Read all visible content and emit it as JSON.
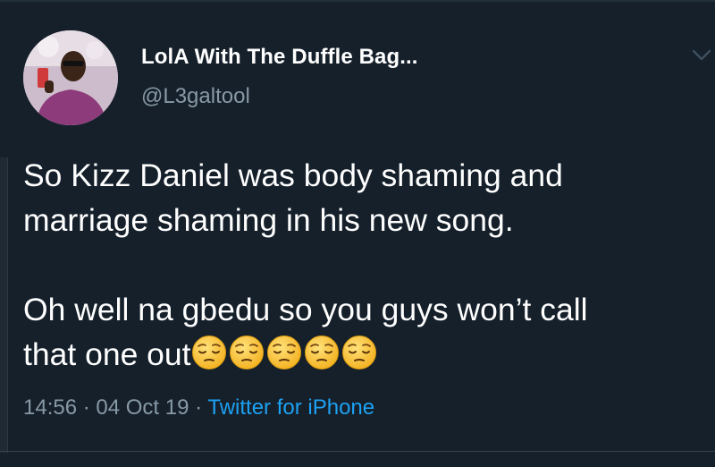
{
  "tweet": {
    "display_name": "LolA With The Duffle Bag...",
    "handle": "@L3galtool",
    "text_line1": "So Kizz Daniel was body shaming and",
    "text_line2": "marriage shaming in his new song.",
    "text_line3": "Oh well na gbedu so you guys won’t call",
    "text_line4": "that one out",
    "emoji_name": "pensive-face-emoji",
    "emoji_count": 5,
    "time": "14:56",
    "separator": " · ",
    "date": "04 Oct 19",
    "source": "Twitter for iPhone"
  },
  "colors": {
    "background": "#15202b",
    "text_primary": "#ffffff",
    "text_secondary": "#8899a6",
    "link": "#1da1f2",
    "divider": "#38444d"
  },
  "icons": {
    "more_menu": "chevron-down-icon"
  }
}
